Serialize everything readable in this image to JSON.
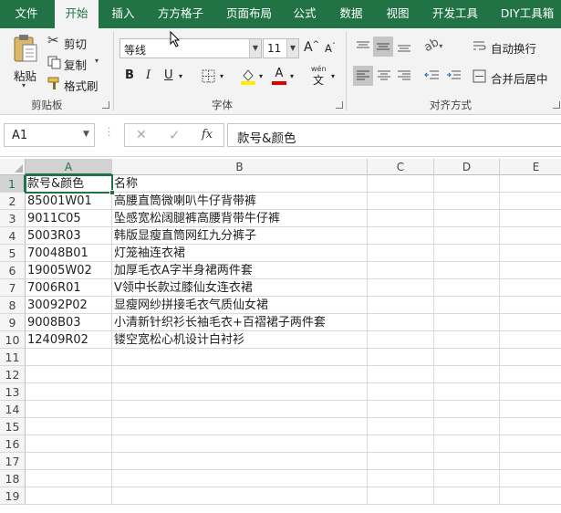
{
  "tabs": [
    {
      "label": "文件",
      "active": false
    },
    {
      "label": "开始",
      "active": true
    },
    {
      "label": "插入",
      "active": false
    },
    {
      "label": "方方格子",
      "active": false
    },
    {
      "label": "页面布局",
      "active": false
    },
    {
      "label": "公式",
      "active": false
    },
    {
      "label": "数据",
      "active": false
    },
    {
      "label": "视图",
      "active": false
    },
    {
      "label": "开发工具",
      "active": false
    },
    {
      "label": "DIY工具箱",
      "active": false
    }
  ],
  "clipboard": {
    "group_label": "剪贴板",
    "paste": "粘贴",
    "cut": "剪切",
    "copy": "复制",
    "format_painter": "格式刷"
  },
  "font": {
    "group_label": "字体",
    "name": "等线",
    "size": "11",
    "bold": "B",
    "italic": "I",
    "underline": "U",
    "grow": "A",
    "shrink": "A",
    "phonetic": "wén"
  },
  "alignment": {
    "group_label": "对齐方式",
    "wrap": "自动换行",
    "merge": "合并后居中"
  },
  "namebox": {
    "value": "A1"
  },
  "formula": {
    "cancel": "✕",
    "enter": "✓",
    "fx": "fx",
    "value": "款号&颜色"
  },
  "columns": [
    "A",
    "B",
    "C",
    "D",
    "E"
  ],
  "rows": [
    "1",
    "2",
    "3",
    "4",
    "5",
    "6",
    "7",
    "8",
    "9",
    "10",
    "11",
    "12",
    "13",
    "14",
    "15",
    "16",
    "17",
    "18",
    "19"
  ],
  "cells": [
    [
      "款号&颜色",
      "名称"
    ],
    [
      "85001W01",
      "高腰直筒微喇叭牛仔背带裤"
    ],
    [
      "9011C05",
      "坠感宽松阔腿裤高腰背带牛仔裤"
    ],
    [
      "5003R03",
      "韩版显瘦直筒网红九分裤子"
    ],
    [
      "70048B01",
      "灯笼袖连衣裙"
    ],
    [
      "19005W02",
      "加厚毛衣A字半身裙两件套"
    ],
    [
      "7006R01",
      "V领中长款过膝仙女连衣裙"
    ],
    [
      "30092P02",
      "显瘦网纱拼接毛衣气质仙女裙"
    ],
    [
      "9008B03",
      "小清新针织衫长袖毛衣+百褶裙子两件套"
    ],
    [
      "12409R02",
      "镂空宽松心机设计白衬衫"
    ]
  ],
  "selected_cell": "A1",
  "colors": {
    "brand": "#217346",
    "selection": "#217346"
  }
}
